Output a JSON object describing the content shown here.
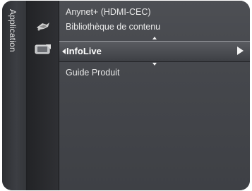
{
  "side_tab": {
    "label": "Application"
  },
  "icons": [
    {
      "name": "anynet-icon"
    },
    {
      "name": "content-library-icon"
    }
  ],
  "menu": {
    "items": [
      {
        "label": "Anynet+ (HDMI-CEC)"
      },
      {
        "label": "Bibliothèque de contenu"
      },
      {
        "label": "InfoLive",
        "selected": true
      },
      {
        "label": "Guide Produit"
      }
    ]
  },
  "colors": {
    "panel": "#3a3c40",
    "menu": "#45474c",
    "text": "#e9e9e9",
    "highlight": "#5a5c61"
  }
}
